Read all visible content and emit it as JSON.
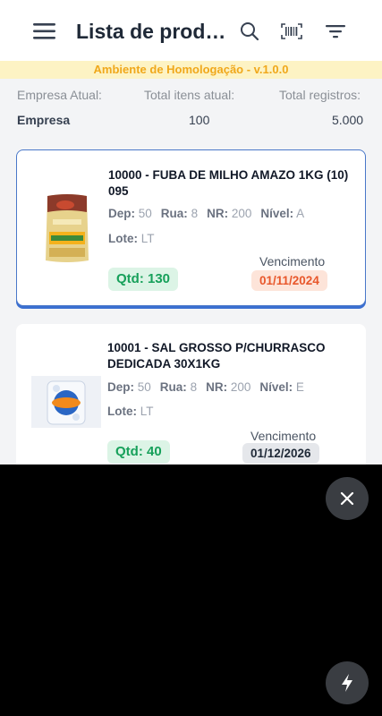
{
  "header": {
    "title": "Lista de prod…",
    "menu_icon": "menu-icon",
    "search_icon": "search-icon",
    "barcode_icon": "barcode-icon",
    "filter_icon": "filter-icon"
  },
  "environment_banner": "Ambiente de Homologação - v.1.0.0",
  "summary": {
    "company_label": "Empresa Atual:",
    "company_value": "Empresa",
    "items_label": "Total itens atual:",
    "items_value": "100",
    "records_label": "Total registros:",
    "records_value": "5.000"
  },
  "products": [
    {
      "name": "10000 - FUBA DE MILHO AMAZO 1KG (10) 095",
      "dep_label": "Dep:",
      "dep": "50",
      "rua_label": "Rua:",
      "rua": "8",
      "nr_label": "NR:",
      "nr": "200",
      "nivel_label": "Nível:",
      "nivel": "A",
      "lote_label": "Lote:",
      "lote": "LT",
      "qty": "Qtd: 130",
      "expiry_label": "Vencimento",
      "expiry": "01/11/2024",
      "expiry_status_color": "#e8572b"
    },
    {
      "name": "10001 - SAL GROSSO P/CHURRASCO DEDICADA 30X1KG",
      "dep_label": "Dep:",
      "dep": "50",
      "rua_label": "Rua:",
      "rua": "8",
      "nr_label": "NR:",
      "nr": "200",
      "nivel_label": "Nível:",
      "nivel": "E",
      "lote_label": "Lote:",
      "lote": "LT",
      "qty": "Qtd: 40",
      "expiry_label": "Vencimento",
      "expiry": "01/12/2026",
      "expiry_status_color": "#1f2937"
    }
  ],
  "overlay": {
    "close_icon": "close-icon",
    "flash_icon": "flash-icon"
  },
  "colors": {
    "accent": "#3b6fd1",
    "qty_green": "#16a05a",
    "banner_text": "#f0a81b"
  }
}
